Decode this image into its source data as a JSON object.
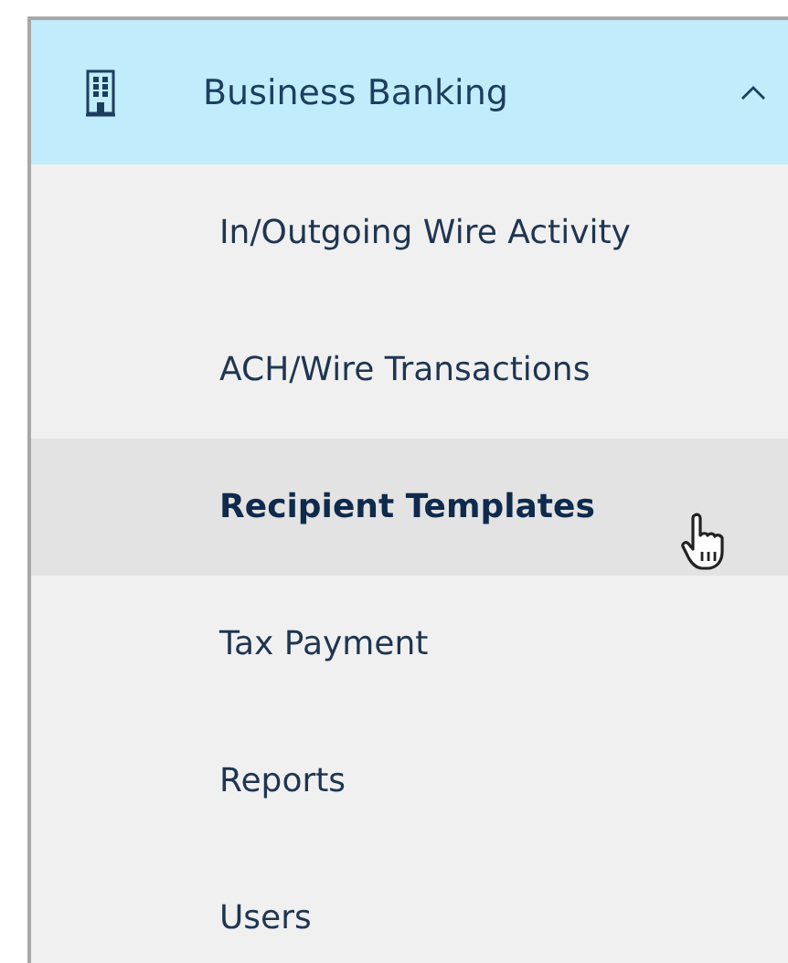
{
  "menu": {
    "title": "Business Banking",
    "expanded": true,
    "items": [
      {
        "label": "In/Outgoing Wire Activity",
        "hovered": false
      },
      {
        "label": "ACH/Wire Transactions",
        "hovered": false
      },
      {
        "label": "Recipient Templates",
        "hovered": true
      },
      {
        "label": "Tax Payment",
        "hovered": false
      },
      {
        "label": "Reports",
        "hovered": false
      },
      {
        "label": "Users",
        "hovered": false
      }
    ]
  }
}
